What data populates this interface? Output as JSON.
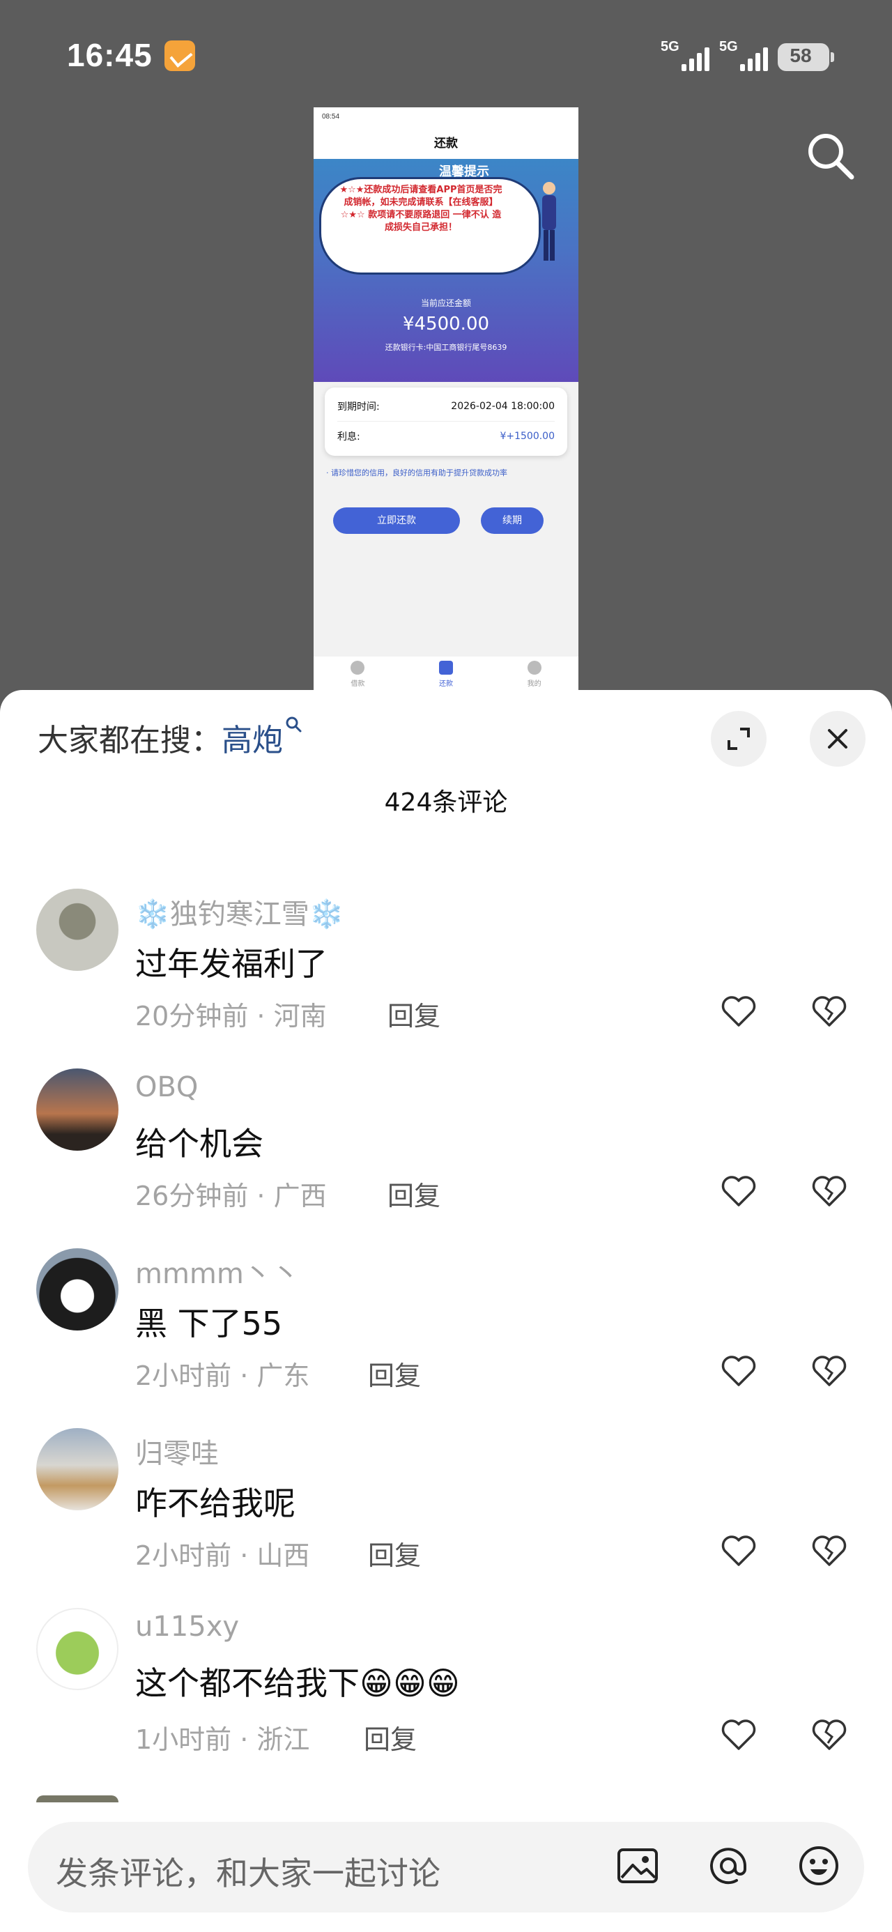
{
  "status_bar": {
    "time": "16:45",
    "signal_1": "5G",
    "signal_2": "5G",
    "battery": "58"
  },
  "embedded_screenshot": {
    "status_time": "08:54",
    "title": "还款",
    "notice_title": "温馨提示",
    "notice_text": "★☆★还款成功后请查看APP首页是否完成销帐，如未完成请联系【在线客服】☆★☆ 款项请不要原路退回 一律不认 造成损失自己承担！",
    "amount_label": "当前应还金额",
    "amount": "¥4500.00",
    "bank_card": "还款银行卡:中国工商银行尾号8639",
    "due_label": "到期时间:",
    "due_value": "2026-02-04 18:00:00",
    "interest_label": "利息:",
    "interest_value": "¥+1500.00",
    "tip": "· 请珍惜您的信用，良好的信用有助于提升贷款成功率",
    "repay_button": "立即还款",
    "renew_button": "续期",
    "tabs": [
      "借款",
      "还款",
      "我的"
    ]
  },
  "sheet": {
    "trending_prefix": "大家都在搜：",
    "trending_keyword": "高炮",
    "comment_count": "424条评论",
    "reply_label": "回复",
    "comments": [
      {
        "user": "❄️独钓寒江雪❄️",
        "text": "过年发福利了",
        "meta": "20分钟前 · 河南"
      },
      {
        "user": "OBQ",
        "text": "给个机会",
        "meta": "26分钟前 · 广西"
      },
      {
        "user": "mmmm丶丶",
        "text": "黑 下了55",
        "meta": "2小时前 · 广东"
      },
      {
        "user": "归零哇",
        "text": "咋不给我呢",
        "meta": "2小时前 · 山西"
      },
      {
        "user": "u115xy",
        "text": "这个都不给我下😁😁😁",
        "meta": "1小时前 · 浙江"
      }
    ],
    "input_placeholder": "发条评论，和大家一起讨论"
  }
}
